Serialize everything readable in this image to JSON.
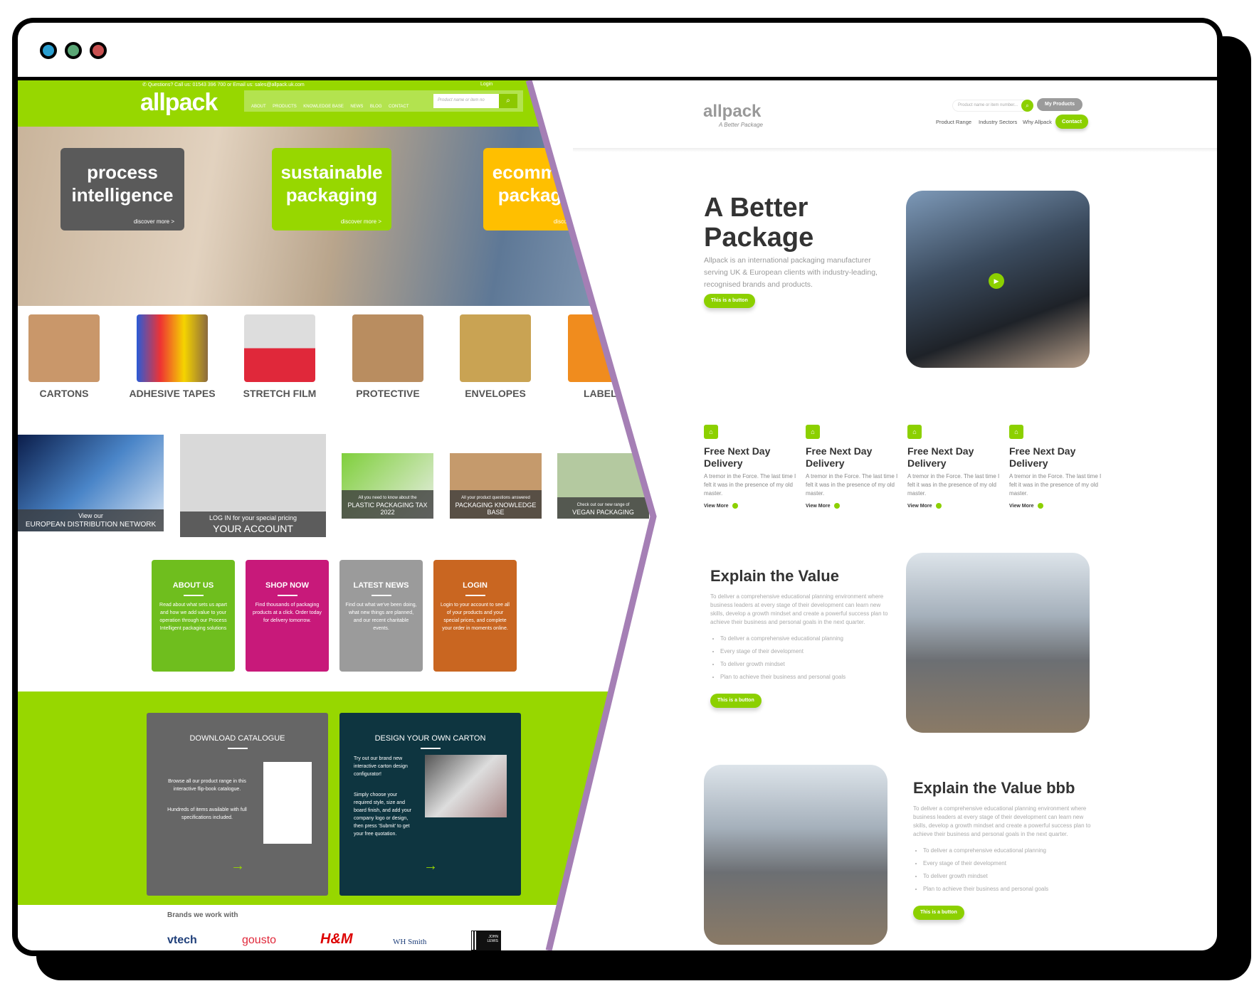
{
  "window": {
    "dots": [
      "#2a9fd0",
      "#5aa675",
      "#c85050"
    ]
  },
  "left": {
    "contact": "Questions? Call us: 01543 396 700 or Email us: sales@allpack.uk.com",
    "login": "Login",
    "logo": "allpack",
    "nav": [
      "ABOUT",
      "PRODUCTS",
      "KNOWLEDGE BASE",
      "NEWS",
      "BLOG",
      "CONTACT"
    ],
    "search_placeholder": "Product name or item no",
    "hero_cards": [
      {
        "title1": "process",
        "title2": "intelligence",
        "link": "discover more  >",
        "color": "#5a5a5a"
      },
      {
        "title1": "sustainable",
        "title2": "packaging",
        "link": "discover more  >",
        "color": "#97d700"
      },
      {
        "title1": "ecommerce",
        "title2": "packaging",
        "link": "discover more  >",
        "color": "#ffbf00"
      }
    ],
    "products": [
      "CARTONS",
      "ADHESIVE TAPES",
      "STRETCH FILM",
      "PROTECTIVE",
      "ENVELOPES",
      "LABELS"
    ],
    "tiles": [
      {
        "small": "View our",
        "big": "EUROPEAN DISTRIBUTION NETWORK"
      },
      {
        "small": "LOG IN for your special pricing",
        "big": "YOUR ACCOUNT"
      },
      {
        "small": "All you need to know about the",
        "big": "PLASTIC PACKAGING TAX 2022"
      },
      {
        "small": "All your product questions answered",
        "big": "PACKAGING KNOWLEDGE BASE"
      },
      {
        "small": "Check out our new range of",
        "big": "VEGAN PACKAGING"
      }
    ],
    "cards": [
      {
        "title": "ABOUT US",
        "text": "Read about what sets us apart and how we add value to your operation through our Process Intelligent packaging solutions",
        "color": "#6fbe1e"
      },
      {
        "title": "SHOP NOW",
        "text": "Find thousands of packaging products at a click. Order today for delivery tomorrow.",
        "color": "#c8197a"
      },
      {
        "title": "LATEST NEWS",
        "text": "Find out what we've been doing, what new things are planned, and our recent charitable events.",
        "color": "#9b9b9b"
      },
      {
        "title": "LOGIN",
        "text": "Login to your account to see all of your products and your special prices, and complete your order in moments online.",
        "color": "#c96621"
      }
    ],
    "boxes": [
      {
        "title": "DOWNLOAD CATALOGUE",
        "p1": "Browse all our product range in this interactive flip-book catalogue.",
        "p2": "Hundreds of items available with full specifications included.",
        "color": "#666666"
      },
      {
        "title": "DESIGN YOUR OWN CARTON",
        "p1": "Try out our brand new interactive carton design configurator!",
        "p2": "Simply choose your required style, size and board finish, and add your company logo or design, then press 'Submit' to get your free quotation.",
        "color": "#0e3540"
      }
    ],
    "brands_title": "Brands we work with",
    "brands": [
      "vtech",
      "gousto",
      "H&M",
      "WH Smith",
      "JOHN LEWIS"
    ]
  },
  "right": {
    "logo": "allpack",
    "tagline": "A Better Package",
    "search_placeholder": "Product name or item number...",
    "my_products": "My Products",
    "nav": [
      "Product Range",
      "Industry Sectors",
      "Why Allpack"
    ],
    "contact": "Contact",
    "hero": {
      "title1": "A Better",
      "title2": "Package",
      "text": "Allpack is an international packaging manufacturer serving UK & European clients with industry-leading, recognised brands and products.",
      "button": "This is a button"
    },
    "features": [
      {
        "title": "Free Next Day Delivery",
        "text": "A tremor in the Force. The last time I felt it was in the presence of my old master.",
        "link": "View More"
      },
      {
        "title": "Free Next Day Delivery",
        "text": "A tremor in the Force. The last time I felt it was in the presence of my old master.",
        "link": "View More"
      },
      {
        "title": "Free Next Day Delivery",
        "text": "A tremor in the Force. The last time I felt it was in the presence of my old master.",
        "link": "View More"
      },
      {
        "title": "Free Next Day Delivery",
        "text": "A tremor in the Force. The last time I felt it was in the presence of my old master.",
        "link": "View More"
      }
    ],
    "sections": [
      {
        "title": "Explain the Value",
        "text": "To deliver a comprehensive educational planning environment where business leaders at every stage of their development can learn new skills, develop a growth mindset and create a powerful success plan to achieve their business and personal goals in the next quarter.",
        "bullets": [
          "To deliver a comprehensive educational planning",
          "Every stage of their development",
          "To deliver growth mindset",
          "Plan to achieve their business and personal goals"
        ],
        "button": "This is a button"
      },
      {
        "title": "Explain the Value bbb",
        "text": "To deliver a comprehensive educational planning environment where business leaders at every stage of their development can learn new skills, develop a growth mindset and create a powerful success plan to achieve their business and personal goals in the next quarter.",
        "bullets": [
          "To deliver a comprehensive educational planning",
          "Every stage of their development",
          "To deliver growth mindset",
          "Plan to achieve their business and personal goals"
        ],
        "button": "This is a button"
      }
    ]
  },
  "colors": {
    "accent": "#97d700",
    "divider": "#a57fb5"
  }
}
